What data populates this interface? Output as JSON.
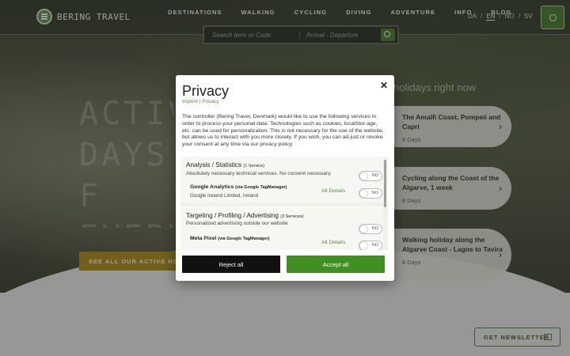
{
  "header": {
    "logo_text": "BERING TRAVEL",
    "nav": [
      "DESTINATIONS",
      "WALKING",
      "CYCLING",
      "DIVING",
      "ADVENTURE",
      "INFO",
      "BLOG"
    ],
    "languages": [
      "DA",
      "EN",
      "NO",
      "SV"
    ],
    "active_language": "EN",
    "search_placeholder": "Search term or Code",
    "date_placeholder": "Arrival - Departure"
  },
  "hero": {
    "title_lines": [
      "ACTIVE",
      "DAYS F",
      "EVERYO"
    ],
    "subtitle": "holidays right now",
    "cta": "SEE ALL OUR ACTIVE HOLIDAYS"
  },
  "cards": [
    {
      "title": "The Amalfi Coast, Pompeii and Capri",
      "days": "8 Days"
    },
    {
      "title": "Cycling along the Coast of the Algarve, 1 week",
      "days": "8 Days"
    },
    {
      "title": "Walking holiday along the Algarve Coast - Lagos to Tavira",
      "days": "8 Days"
    }
  ],
  "newsletter": "GET NEWSLETTER",
  "privacy": {
    "title": "Privacy",
    "imprint": "Imprint",
    "privacy_link": "Privacy",
    "body": "The controller (Bering Travel, Denmark) would like to use the following services in order to process your personal data. Technologies such as cookies, localStor-age, etc. can be used for personalization. This is not necessary for the use of the website, but allows us to interact with you more closely. If you wish, you can ad-just or revoke your consent at any time via our privacy policy.",
    "categories": [
      {
        "title": "Analysis / Statistics",
        "count": "(1 Service)",
        "desc": "Absolutely necessary technical services. No consent necessary.",
        "service": "Google Analytics",
        "service_via": "(via Google TagManager)",
        "service_sub": "Google Ireland Limited, Ireland"
      },
      {
        "title": "Targeting / Profiling / Advertising",
        "count": "(3 Services)",
        "desc": "Personalized advertising outside our website",
        "service": "Meta Pixel",
        "service_via": "(via Google TagManager)"
      }
    ],
    "details_label": "All Details",
    "toggle_label": "NO",
    "reject": "Reject all",
    "accept": "Accept all"
  },
  "colors": {
    "accent": "#3f8f23",
    "link": "#5b8a3c",
    "cta": "#b89a2a"
  }
}
